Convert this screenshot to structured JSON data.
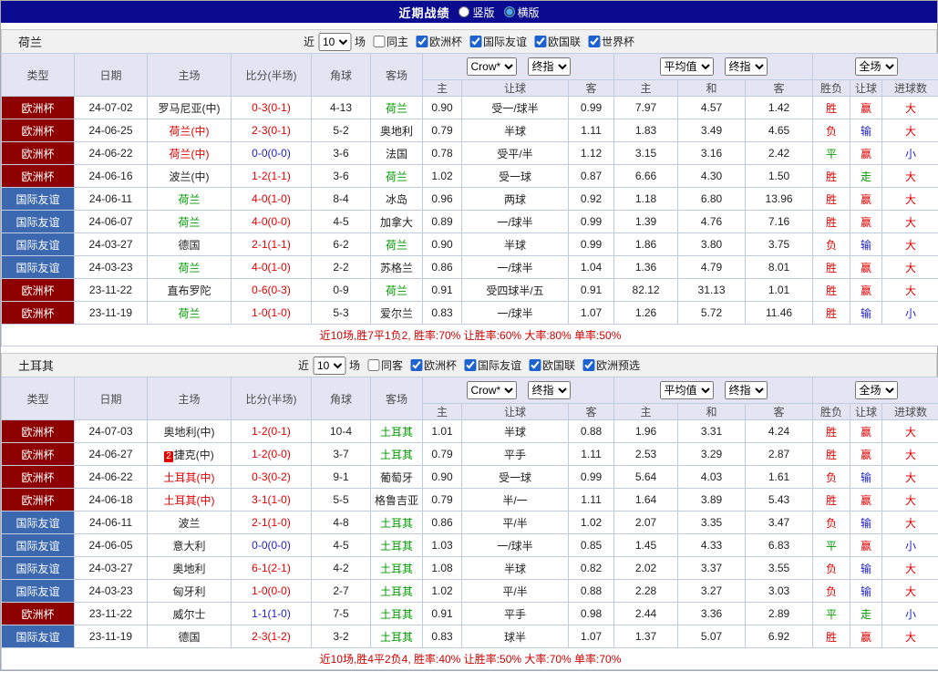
{
  "topbar": {
    "title": "近期战绩",
    "layout_options": [
      {
        "label": "竖版",
        "selected": false
      },
      {
        "label": "横版",
        "selected": true
      }
    ]
  },
  "colors": {
    "euro_cup_bg": "#8e0000",
    "friendly_bg": "#3c68b0",
    "win_red": "#e00000",
    "lose_blue": "#2020cc",
    "team_green": "#009900",
    "topbar_navy": "#0b0b8f"
  },
  "sections": [
    {
      "team": "荷兰",
      "filter": {
        "near_label": "近",
        "count": "10",
        "games_label": "场",
        "same_label": "同主",
        "same_checked": false,
        "competitions": [
          {
            "label": "欧洲杯",
            "checked": true
          },
          {
            "label": "国际友谊",
            "checked": true
          },
          {
            "label": "欧国联",
            "checked": true
          },
          {
            "label": "世界杯",
            "checked": true
          }
        ]
      },
      "table": {
        "headers": {
          "type": "类型",
          "date": "日期",
          "home": "主场",
          "score": "比分(半场)",
          "corner": "角球",
          "away": "客场",
          "odds_selects": [
            "Crow*",
            "终指"
          ],
          "avg_selects": [
            "平均值",
            "终指"
          ],
          "result_select": "全场",
          "sub": [
            "主",
            "让球",
            "客",
            "主",
            "和",
            "客",
            "胜负",
            "让球",
            "进球数"
          ]
        },
        "rows": [
          {
            "type": "欧洲杯",
            "tc": "e",
            "date": "24-07-02",
            "home": "罗马尼亚(中)",
            "hc": "k",
            "card": "",
            "score": "0-3(0-1)",
            "sc": "r",
            "corner": "4-13",
            "away": "荷兰",
            "ac": "g",
            "o1": "0.90",
            "let": "受一/球半",
            "o2": "0.99",
            "m1": "7.97",
            "m2": "4.57",
            "m3": "1.42",
            "r1": "胜",
            "r1c": "r",
            "r2": "赢",
            "r2c": "r",
            "r3": "大",
            "r3c": "r"
          },
          {
            "type": "欧洲杯",
            "tc": "e",
            "date": "24-06-25",
            "home": "荷兰(中)",
            "hc": "r",
            "card": "",
            "score": "2-3(0-1)",
            "sc": "r",
            "corner": "5-2",
            "away": "奥地利",
            "ac": "k",
            "o1": "0.79",
            "let": "半球",
            "o2": "1.11",
            "m1": "1.83",
            "m2": "3.49",
            "m3": "4.65",
            "r1": "负",
            "r1c": "r",
            "r2": "输",
            "r2c": "b",
            "r3": "大",
            "r3c": "r"
          },
          {
            "type": "欧洲杯",
            "tc": "e",
            "date": "24-06-22",
            "home": "荷兰(中)",
            "hc": "r",
            "card": "",
            "score": "0-0(0-0)",
            "sc": "b",
            "corner": "3-6",
            "away": "法国",
            "ac": "k",
            "o1": "0.78",
            "let": "受平/半",
            "o2": "1.12",
            "m1": "3.15",
            "m2": "3.16",
            "m3": "2.42",
            "r1": "平",
            "r1c": "g",
            "r2": "赢",
            "r2c": "r",
            "r3": "小",
            "r3c": "b"
          },
          {
            "type": "欧洲杯",
            "tc": "e",
            "date": "24-06-16",
            "home": "波兰(中)",
            "hc": "k",
            "card": "",
            "score": "1-2(1-1)",
            "sc": "r",
            "corner": "3-6",
            "away": "荷兰",
            "ac": "g",
            "o1": "1.02",
            "let": "受一球",
            "o2": "0.87",
            "m1": "6.66",
            "m2": "4.30",
            "m3": "1.50",
            "r1": "胜",
            "r1c": "r",
            "r2": "走",
            "r2c": "g",
            "r3": "大",
            "r3c": "r"
          },
          {
            "type": "国际友谊",
            "tc": "f",
            "date": "24-06-11",
            "home": "荷兰",
            "hc": "g",
            "card": "",
            "score": "4-0(1-0)",
            "sc": "r",
            "corner": "8-4",
            "away": "冰岛",
            "ac": "k",
            "o1": "0.96",
            "let": "两球",
            "o2": "0.92",
            "m1": "1.18",
            "m2": "6.80",
            "m3": "13.96",
            "r1": "胜",
            "r1c": "r",
            "r2": "赢",
            "r2c": "r",
            "r3": "大",
            "r3c": "r"
          },
          {
            "type": "国际友谊",
            "tc": "f",
            "date": "24-06-07",
            "home": "荷兰",
            "hc": "g",
            "card": "",
            "score": "4-0(0-0)",
            "sc": "r",
            "corner": "4-5",
            "away": "加拿大",
            "ac": "k",
            "o1": "0.89",
            "let": "一/球半",
            "o2": "0.99",
            "m1": "1.39",
            "m2": "4.76",
            "m3": "7.16",
            "r1": "胜",
            "r1c": "r",
            "r2": "赢",
            "r2c": "r",
            "r3": "大",
            "r3c": "r"
          },
          {
            "type": "国际友谊",
            "tc": "f",
            "date": "24-03-27",
            "home": "德国",
            "hc": "k",
            "card": "",
            "score": "2-1(1-1)",
            "sc": "r",
            "corner": "6-2",
            "away": "荷兰",
            "ac": "g",
            "o1": "0.90",
            "let": "半球",
            "o2": "0.99",
            "m1": "1.86",
            "m2": "3.80",
            "m3": "3.75",
            "r1": "负",
            "r1c": "r",
            "r2": "输",
            "r2c": "b",
            "r3": "大",
            "r3c": "r"
          },
          {
            "type": "国际友谊",
            "tc": "f",
            "date": "24-03-23",
            "home": "荷兰",
            "hc": "g",
            "card": "",
            "score": "4-0(1-0)",
            "sc": "r",
            "corner": "2-2",
            "away": "苏格兰",
            "ac": "k",
            "o1": "0.86",
            "let": "一/球半",
            "o2": "1.04",
            "m1": "1.36",
            "m2": "4.79",
            "m3": "8.01",
            "r1": "胜",
            "r1c": "r",
            "r2": "赢",
            "r2c": "r",
            "r3": "大",
            "r3c": "r"
          },
          {
            "type": "欧洲杯",
            "tc": "e",
            "date": "23-11-22",
            "home": "直布罗陀",
            "hc": "k",
            "card": "",
            "score": "0-6(0-3)",
            "sc": "r",
            "corner": "0-9",
            "away": "荷兰",
            "ac": "g",
            "o1": "0.91",
            "let": "受四球半/五",
            "o2": "0.91",
            "m1": "82.12",
            "m2": "31.13",
            "m3": "1.01",
            "r1": "胜",
            "r1c": "r",
            "r2": "赢",
            "r2c": "r",
            "r3": "大",
            "r3c": "r"
          },
          {
            "type": "欧洲杯",
            "tc": "e",
            "date": "23-11-19",
            "home": "荷兰",
            "hc": "g",
            "card": "",
            "score": "1-0(1-0)",
            "sc": "r",
            "corner": "5-3",
            "away": "爱尔兰",
            "ac": "k",
            "o1": "0.83",
            "let": "一/球半",
            "o2": "1.07",
            "m1": "1.26",
            "m2": "5.72",
            "m3": "11.46",
            "r1": "胜",
            "r1c": "r",
            "r2": "输",
            "r2c": "b",
            "r3": "小",
            "r3c": "b"
          }
        ],
        "summary": "近10场,胜7平1负2, 胜率:70% 让胜率:60% 大率:80% 单率:50%"
      }
    },
    {
      "team": "土耳其",
      "filter": {
        "near_label": "近",
        "count": "10",
        "games_label": "场",
        "same_label": "同客",
        "same_checked": false,
        "competitions": [
          {
            "label": "欧洲杯",
            "checked": true
          },
          {
            "label": "国际友谊",
            "checked": true
          },
          {
            "label": "欧国联",
            "checked": true
          },
          {
            "label": "欧洲预选",
            "checked": true
          }
        ]
      },
      "table": {
        "headers": {
          "type": "类型",
          "date": "日期",
          "home": "主场",
          "score": "比分(半场)",
          "corner": "角球",
          "away": "客场",
          "odds_selects": [
            "Crow*",
            "终指"
          ],
          "avg_selects": [
            "平均值",
            "终指"
          ],
          "result_select": "全场",
          "sub": [
            "主",
            "让球",
            "客",
            "主",
            "和",
            "客",
            "胜负",
            "让球",
            "进球数"
          ]
        },
        "rows": [
          {
            "type": "欧洲杯",
            "tc": "e",
            "date": "24-07-03",
            "home": "奥地利(中)",
            "hc": "k",
            "card": "",
            "score": "1-2(0-1)",
            "sc": "r",
            "corner": "10-4",
            "away": "土耳其",
            "ac": "g",
            "o1": "1.01",
            "let": "半球",
            "o2": "0.88",
            "m1": "1.96",
            "m2": "3.31",
            "m3": "4.24",
            "r1": "胜",
            "r1c": "r",
            "r2": "赢",
            "r2c": "r",
            "r3": "大",
            "r3c": "r"
          },
          {
            "type": "欧洲杯",
            "tc": "e",
            "date": "24-06-27",
            "home": "捷克(中)",
            "hc": "k",
            "card": "2",
            "score": "1-2(0-0)",
            "sc": "r",
            "corner": "3-7",
            "away": "土耳其",
            "ac": "g",
            "o1": "0.79",
            "let": "平手",
            "o2": "1.11",
            "m1": "2.53",
            "m2": "3.29",
            "m3": "2.87",
            "r1": "胜",
            "r1c": "r",
            "r2": "赢",
            "r2c": "r",
            "r3": "大",
            "r3c": "r"
          },
          {
            "type": "欧洲杯",
            "tc": "e",
            "date": "24-06-22",
            "home": "土耳其(中)",
            "hc": "r",
            "card": "",
            "score": "0-3(0-2)",
            "sc": "r",
            "corner": "9-1",
            "away": "葡萄牙",
            "ac": "k",
            "o1": "0.90",
            "let": "受一球",
            "o2": "0.99",
            "m1": "5.64",
            "m2": "4.03",
            "m3": "1.61",
            "r1": "负",
            "r1c": "r",
            "r2": "输",
            "r2c": "b",
            "r3": "大",
            "r3c": "r"
          },
          {
            "type": "欧洲杯",
            "tc": "e",
            "date": "24-06-18",
            "home": "土耳其(中)",
            "hc": "r",
            "card": "",
            "score": "3-1(1-0)",
            "sc": "r",
            "corner": "5-5",
            "away": "格鲁吉亚",
            "ac": "k",
            "o1": "0.79",
            "let": "半/一",
            "o2": "1.11",
            "m1": "1.64",
            "m2": "3.89",
            "m3": "5.43",
            "r1": "胜",
            "r1c": "r",
            "r2": "赢",
            "r2c": "r",
            "r3": "大",
            "r3c": "r"
          },
          {
            "type": "国际友谊",
            "tc": "f",
            "date": "24-06-11",
            "home": "波兰",
            "hc": "k",
            "card": "",
            "score": "2-1(1-0)",
            "sc": "r",
            "corner": "4-8",
            "away": "土耳其",
            "ac": "g",
            "o1": "0.86",
            "let": "平/半",
            "o2": "1.02",
            "m1": "2.07",
            "m2": "3.35",
            "m3": "3.47",
            "r1": "负",
            "r1c": "r",
            "r2": "输",
            "r2c": "b",
            "r3": "大",
            "r3c": "r"
          },
          {
            "type": "国际友谊",
            "tc": "f",
            "date": "24-06-05",
            "home": "意大利",
            "hc": "k",
            "card": "",
            "score": "0-0(0-0)",
            "sc": "b",
            "corner": "4-5",
            "away": "土耳其",
            "ac": "g",
            "o1": "1.03",
            "let": "一/球半",
            "o2": "0.85",
            "m1": "1.45",
            "m2": "4.33",
            "m3": "6.83",
            "r1": "平",
            "r1c": "g",
            "r2": "赢",
            "r2c": "r",
            "r3": "小",
            "r3c": "b"
          },
          {
            "type": "国际友谊",
            "tc": "f",
            "date": "24-03-27",
            "home": "奥地利",
            "hc": "k",
            "card": "",
            "score": "6-1(2-1)",
            "sc": "r",
            "corner": "4-2",
            "away": "土耳其",
            "ac": "g",
            "o1": "1.08",
            "let": "半球",
            "o2": "0.82",
            "m1": "2.02",
            "m2": "3.37",
            "m3": "3.55",
            "r1": "负",
            "r1c": "r",
            "r2": "输",
            "r2c": "b",
            "r3": "大",
            "r3c": "r"
          },
          {
            "type": "国际友谊",
            "tc": "f",
            "date": "24-03-23",
            "home": "匈牙利",
            "hc": "k",
            "card": "",
            "score": "1-0(0-0)",
            "sc": "r",
            "corner": "2-7",
            "away": "土耳其",
            "ac": "g",
            "o1": "1.02",
            "let": "平/半",
            "o2": "0.88",
            "m1": "2.28",
            "m2": "3.27",
            "m3": "3.03",
            "r1": "负",
            "r1c": "r",
            "r2": "输",
            "r2c": "b",
            "r3": "大",
            "r3c": "r"
          },
          {
            "type": "欧洲杯",
            "tc": "e",
            "date": "23-11-22",
            "home": "威尔士",
            "hc": "k",
            "card": "",
            "score": "1-1(1-0)",
            "sc": "b",
            "corner": "7-5",
            "away": "土耳其",
            "ac": "g",
            "o1": "0.91",
            "let": "平手",
            "o2": "0.98",
            "m1": "2.44",
            "m2": "3.36",
            "m3": "2.89",
            "r1": "平",
            "r1c": "g",
            "r2": "走",
            "r2c": "g",
            "r3": "小",
            "r3c": "b"
          },
          {
            "type": "国际友谊",
            "tc": "f",
            "date": "23-11-19",
            "home": "德国",
            "hc": "k",
            "card": "",
            "score": "2-3(1-2)",
            "sc": "r",
            "corner": "3-2",
            "away": "土耳其",
            "ac": "g",
            "o1": "0.83",
            "let": "球半",
            "o2": "1.07",
            "m1": "1.37",
            "m2": "5.07",
            "m3": "6.92",
            "r1": "胜",
            "r1c": "r",
            "r2": "赢",
            "r2c": "r",
            "r3": "大",
            "r3c": "r"
          }
        ],
        "summary": "近10场,胜4平2负4, 胜率:40% 让胜率:50% 大率:70% 单率:70%"
      }
    }
  ]
}
